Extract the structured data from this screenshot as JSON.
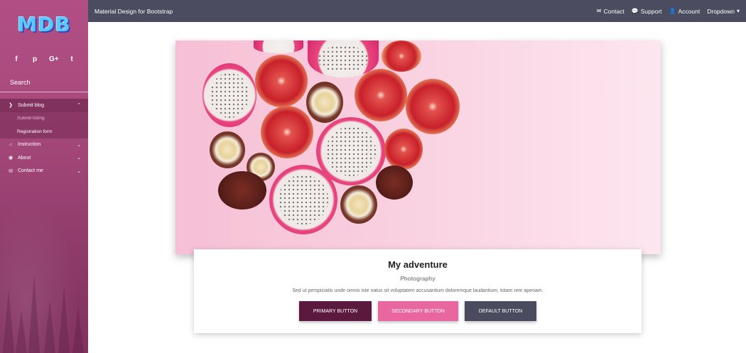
{
  "sidebar": {
    "logo": "MDB",
    "social": [
      {
        "icon": "facebook-icon",
        "glyph": "f"
      },
      {
        "icon": "pinterest-icon",
        "glyph": "p"
      },
      {
        "icon": "google-plus-icon",
        "glyph": "G+"
      },
      {
        "icon": "twitter-icon",
        "glyph": "t"
      }
    ],
    "search_label": "Search",
    "menu": [
      {
        "label": "Submit blog",
        "icon": "chevron-right-icon",
        "expanded": true,
        "sub": [
          "Submit listing",
          "Registration form"
        ]
      },
      {
        "label": "Instruction",
        "icon": "hand-pointer-icon"
      },
      {
        "label": "About",
        "icon": "eye-icon"
      },
      {
        "label": "Contact me",
        "icon": "envelope-icon"
      }
    ]
  },
  "topbar": {
    "brand": "Material Design for Bootstrap",
    "nav": [
      {
        "label": "Contact",
        "icon": "envelope-icon"
      },
      {
        "label": "Support",
        "icon": "comments-icon"
      },
      {
        "label": "Account",
        "icon": "user-icon"
      },
      {
        "label": "Dropdown",
        "icon": "caret-down-icon"
      }
    ]
  },
  "card": {
    "title": "My adventure",
    "subtitle": "Photography",
    "description": "Sed ut perspiciatis unde omnis iste natus sit voluptatem accusantium doloremque laudantium, totam rem aperiam.",
    "buttons": {
      "primary": "Primary button",
      "secondary": "Secondary button",
      "default": "Default button"
    }
  },
  "colors": {
    "topbar": "#4c4c60",
    "primary": "#5b1a3d",
    "secondary": "#e8679e",
    "default": "#4b4b5f"
  }
}
